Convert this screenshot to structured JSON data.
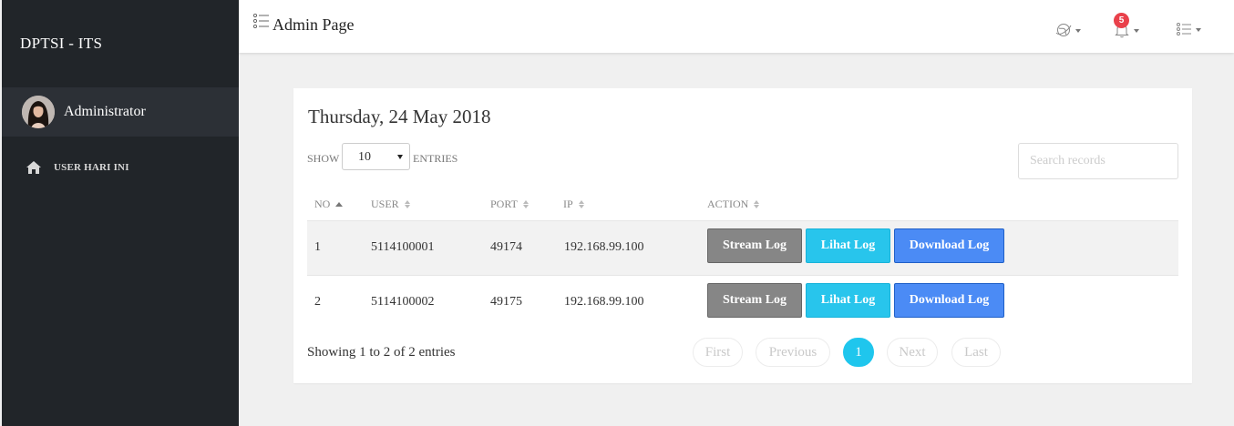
{
  "sidebar": {
    "brand": "DPTSI - ITS",
    "user_name": "Administrator",
    "nav_items": [
      {
        "label": "USER HARI INI",
        "icon": "home-icon"
      }
    ]
  },
  "topbar": {
    "title": "Admin Page",
    "menu_icon": "list-icon",
    "icons": [
      "globe-icon",
      "bell-icon",
      "list-icon"
    ],
    "notification_count": "5"
  },
  "card": {
    "date": "Thursday, 24 May 2018",
    "show_label": "SHOW",
    "entries_value": "10",
    "entries_label": "ENTRIES",
    "search_placeholder": "Search records"
  },
  "table": {
    "headers": [
      "NO",
      "USER",
      "PORT",
      "IP",
      "ACTION"
    ],
    "rows": [
      {
        "no": "1",
        "user": "5114100001",
        "port": "49174",
        "ip": "192.168.99.100"
      },
      {
        "no": "2",
        "user": "5114100002",
        "port": "49175",
        "ip": "192.168.99.100"
      }
    ],
    "actions": {
      "stream": "Stream Log",
      "lihat": "Lihat Log",
      "download": "Download Log"
    }
  },
  "footer": {
    "showing": "Showing 1 to 2 of 2 entries",
    "pagination": {
      "first": "First",
      "previous": "Previous",
      "current": "1",
      "next": "Next",
      "last": "Last"
    }
  },
  "colors": {
    "sidebar_bg": "#212529",
    "accent_cyan": "#28c5ec",
    "accent_blue": "#4b8bf5",
    "button_gray": "#868686",
    "badge_red": "#e9414b"
  }
}
